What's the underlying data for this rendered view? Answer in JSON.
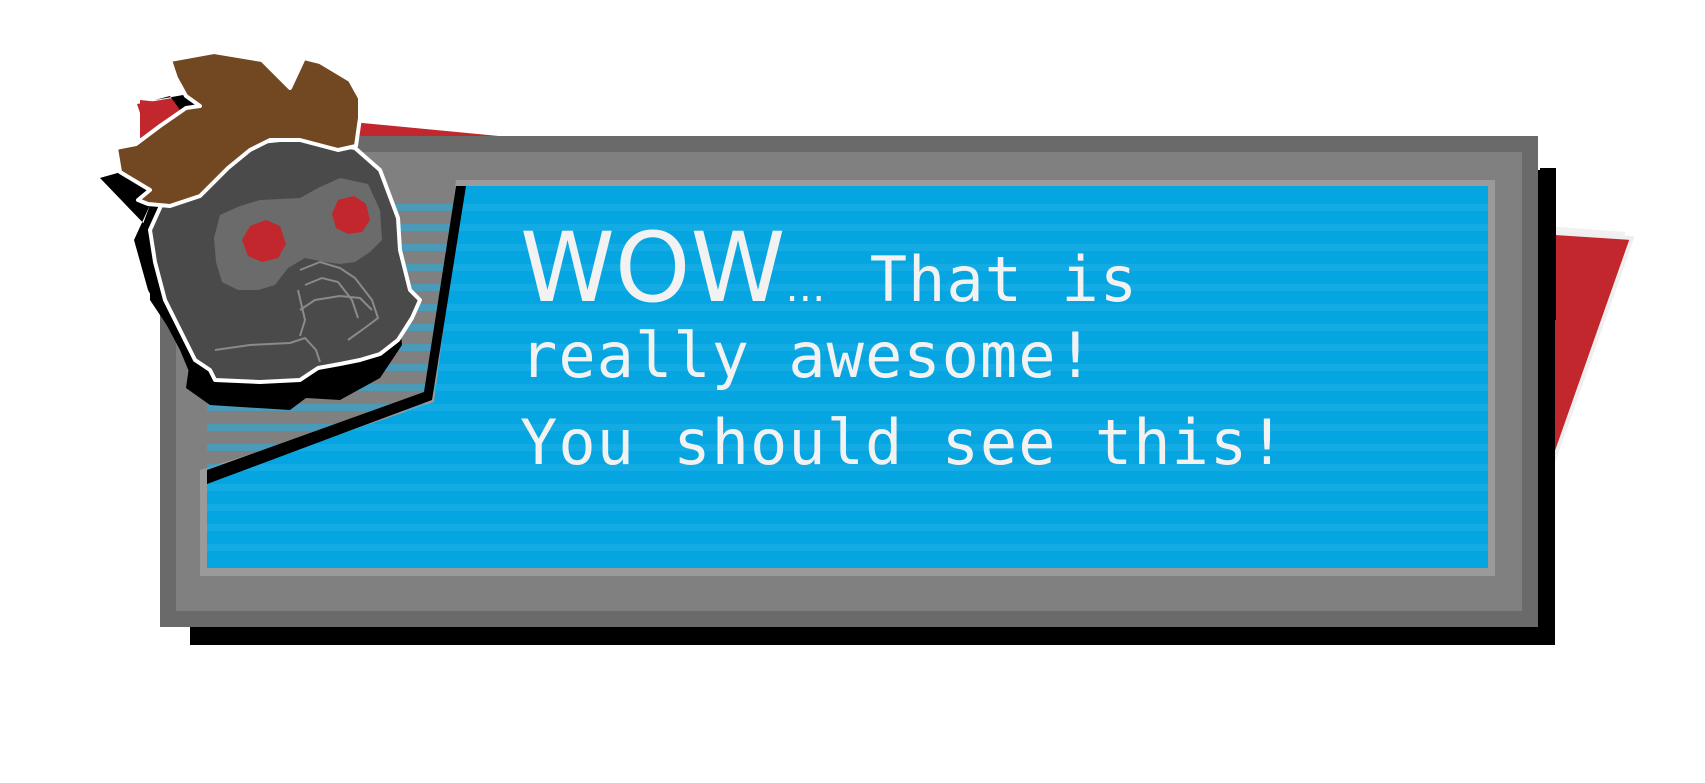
{
  "dialog": {
    "exclamation": "WOW",
    "ellipsis": "…",
    "line1_rest": "That is",
    "line2": "really awesome!",
    "line3": "You should see this!"
  },
  "portrait": {
    "icon": "star-lord-helmet-icon",
    "description_name": "speaker-portrait"
  },
  "colors": {
    "red_backdrop": "#c0272d",
    "dark_red_edge": "#a8191f",
    "frame_gray": "#808080",
    "frame_dark": "#666666",
    "screen_blue": "#05a5e2",
    "screen_stripe": "#1fb0e6",
    "text": "#f2f2f2",
    "hair": "#724822",
    "helmet": "#4a4a4a",
    "helmet_face": "#6b6b6b",
    "eyes": "#c1272d"
  }
}
